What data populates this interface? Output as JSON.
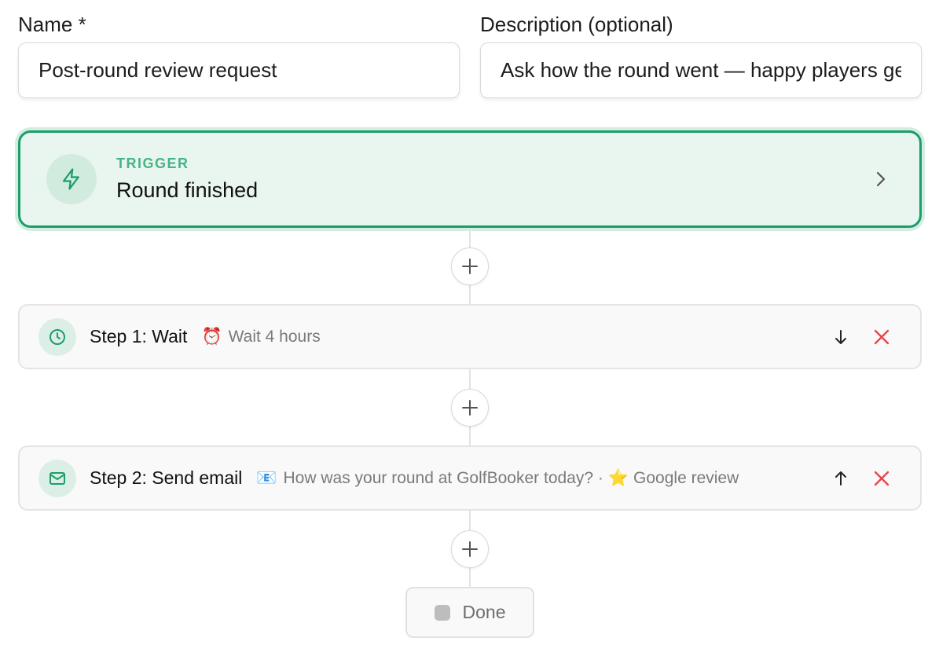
{
  "form": {
    "name_label": "Name *",
    "name_value": "Post-round review request",
    "description_label": "Description (optional)",
    "description_value": "Ask how the round went — happy players get a Google review link"
  },
  "trigger": {
    "kicker": "TRIGGER",
    "title": "Round finished",
    "icon": "lightning-icon"
  },
  "steps": [
    {
      "title": "Step 1: Wait",
      "icon": "clock-icon",
      "summary_emoji": "⏰",
      "summary": "Wait 4 hours",
      "move_icon": "arrow-down-icon"
    },
    {
      "title": "Step 2: Send email",
      "icon": "mail-icon",
      "summary_emoji": "📧",
      "summary": "How was your round at GolfBooker today? ·",
      "summary_emoji2": "⭐",
      "summary2": "Google review",
      "move_icon": "arrow-up-icon"
    }
  ],
  "done": {
    "label": "Done"
  },
  "colors": {
    "accent": "#1c9d6a",
    "accent_bg": "#e9f5ef",
    "danger": "#e5484d"
  }
}
